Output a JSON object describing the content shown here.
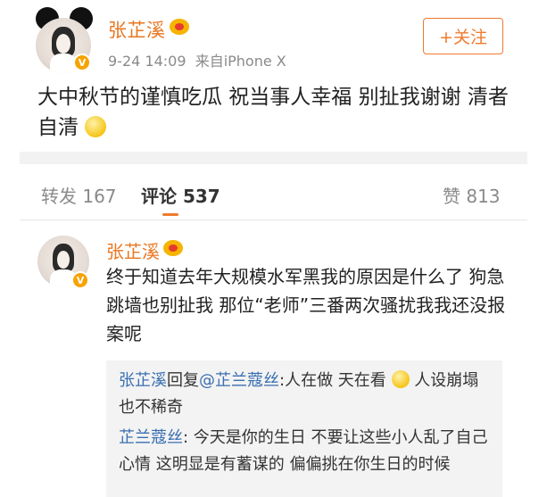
{
  "post": {
    "author": "张芷溪",
    "time": "9-24 14:09",
    "source": "来自iPhone X",
    "follow_label": "+关注",
    "text": "大中秋节的谨慎吃瓜 祝当事人幸福 别扯我谢谢 清者自清",
    "verified_badge": "V"
  },
  "tabs": {
    "repost_label": "转发",
    "repost_count": "167",
    "comment_label": "评论",
    "comment_count": "537",
    "like_label": "赞",
    "like_count": "813"
  },
  "comment": {
    "author": "张芷溪",
    "text": "终于知道去年大规模水军黑我的原因是什么了 狗急跳墙也别扯我 那位“老师”三番两次骚扰我我还没报案呢",
    "verified_badge": "V"
  },
  "replies": [
    {
      "user": "张芷溪",
      "connector": "回复",
      "target": "@芷兰蔻丝",
      "text": ":人在做 天在看",
      "text_after": " 人设崩塌也不稀奇"
    },
    {
      "user": "芷兰蔻丝",
      "text": ": 今天是你的生日  不要让这些小人乱了自己心情  这明显是有蓄谋的  偏偏挑在你生日的时候"
    }
  ],
  "colors": {
    "accent_orange": "#e87722",
    "link_blue": "#3a6fb0",
    "verified_gold": "#f7a300"
  }
}
